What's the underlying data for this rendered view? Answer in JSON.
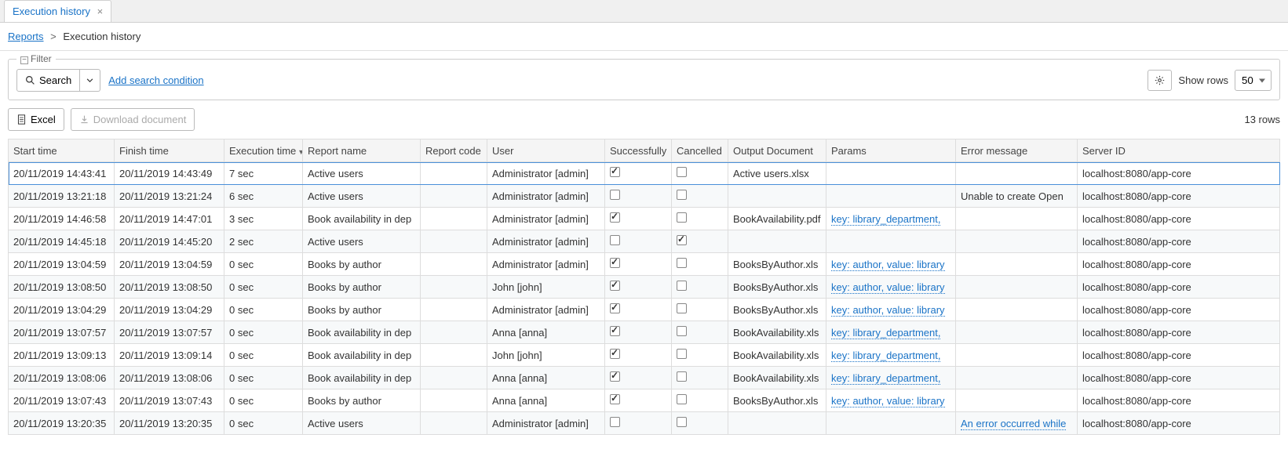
{
  "tab": {
    "label": "Execution history"
  },
  "breadcrumb": {
    "root": "Reports",
    "sep": ">",
    "current": "Execution history"
  },
  "filter": {
    "legend": "Filter",
    "search_label": "Search",
    "add_condition": "Add search condition",
    "show_rows_label": "Show rows",
    "show_rows_value": "50"
  },
  "toolbar": {
    "excel": "Excel",
    "download": "Download document",
    "rows_count": "13 rows"
  },
  "columns": {
    "start": "Start time",
    "finish": "Finish time",
    "exec": "Execution time",
    "name": "Report name",
    "code": "Report code",
    "user": "User",
    "succ": "Successfully",
    "canc": "Cancelled",
    "out": "Output Document",
    "params": "Params",
    "err": "Error message",
    "srv": "Server ID"
  },
  "rows": [
    {
      "start": "20/11/2019 14:43:41",
      "finish": "20/11/2019 14:43:49",
      "exec": "7 sec",
      "name": "Active users",
      "code": "",
      "user": "Administrator [admin]",
      "succ": true,
      "canc": false,
      "out": "Active users.xlsx",
      "params": "",
      "err": "",
      "srv": "localhost:8080/app-core",
      "selected": true
    },
    {
      "start": "20/11/2019 13:21:18",
      "finish": "20/11/2019 13:21:24",
      "exec": "6 sec",
      "name": "Active users",
      "code": "",
      "user": "Administrator [admin]",
      "succ": false,
      "canc": false,
      "out": "",
      "params": "",
      "err": "Unable to create Open ",
      "srv": "localhost:8080/app-core"
    },
    {
      "start": "20/11/2019 14:46:58",
      "finish": "20/11/2019 14:47:01",
      "exec": "3 sec",
      "name": "Book availability in dep",
      "code": "",
      "user": "Administrator [admin]",
      "succ": true,
      "canc": false,
      "out": "BookAvailability.pdf",
      "params": "key: library_department, ",
      "err": "",
      "srv": "localhost:8080/app-core"
    },
    {
      "start": "20/11/2019 14:45:18",
      "finish": "20/11/2019 14:45:20",
      "exec": "2 sec",
      "name": "Active users",
      "code": "",
      "user": "Administrator [admin]",
      "succ": false,
      "canc": true,
      "out": "",
      "params": "",
      "err": "",
      "srv": "localhost:8080/app-core"
    },
    {
      "start": "20/11/2019 13:04:59",
      "finish": "20/11/2019 13:04:59",
      "exec": "0 sec",
      "name": "Books by author",
      "code": "",
      "user": "Administrator [admin]",
      "succ": true,
      "canc": false,
      "out": "BooksByAuthor.xls",
      "params": "key: author, value: library",
      "err": "",
      "srv": "localhost:8080/app-core"
    },
    {
      "start": "20/11/2019 13:08:50",
      "finish": "20/11/2019 13:08:50",
      "exec": "0 sec",
      "name": "Books by author",
      "code": "",
      "user": "John [john]",
      "succ": true,
      "canc": false,
      "out": "BooksByAuthor.xls",
      "params": "key: author, value: library",
      "err": "",
      "srv": "localhost:8080/app-core"
    },
    {
      "start": "20/11/2019 13:04:29",
      "finish": "20/11/2019 13:04:29",
      "exec": "0 sec",
      "name": "Books by author",
      "code": "",
      "user": "Administrator [admin]",
      "succ": true,
      "canc": false,
      "out": "BooksByAuthor.xls",
      "params": "key: author, value: library",
      "err": "",
      "srv": "localhost:8080/app-core"
    },
    {
      "start": "20/11/2019 13:07:57",
      "finish": "20/11/2019 13:07:57",
      "exec": "0 sec",
      "name": "Book availability in dep",
      "code": "",
      "user": "Anna [anna]",
      "succ": true,
      "canc": false,
      "out": "BookAvailability.xls",
      "params": "key: library_department, ",
      "err": "",
      "srv": "localhost:8080/app-core"
    },
    {
      "start": "20/11/2019 13:09:13",
      "finish": "20/11/2019 13:09:14",
      "exec": "0 sec",
      "name": "Book availability in dep",
      "code": "",
      "user": "John [john]",
      "succ": true,
      "canc": false,
      "out": "BookAvailability.xls",
      "params": "key: library_department, ",
      "err": "",
      "srv": "localhost:8080/app-core"
    },
    {
      "start": "20/11/2019 13:08:06",
      "finish": "20/11/2019 13:08:06",
      "exec": "0 sec",
      "name": "Book availability in dep",
      "code": "",
      "user": "Anna [anna]",
      "succ": true,
      "canc": false,
      "out": "BookAvailability.xls",
      "params": "key: library_department, ",
      "err": "",
      "srv": "localhost:8080/app-core"
    },
    {
      "start": "20/11/2019 13:07:43",
      "finish": "20/11/2019 13:07:43",
      "exec": "0 sec",
      "name": "Books by author",
      "code": "",
      "user": "Anna [anna]",
      "succ": true,
      "canc": false,
      "out": "BooksByAuthor.xls",
      "params": "key: author, value: library",
      "err": "",
      "srv": "localhost:8080/app-core"
    },
    {
      "start": "20/11/2019 13:20:35",
      "finish": "20/11/2019 13:20:35",
      "exec": "0 sec",
      "name": "Active users",
      "code": "",
      "user": "Administrator [admin]",
      "succ": false,
      "canc": false,
      "out": "",
      "params": "",
      "err": "An error occurred while",
      "err_link": true,
      "srv": "localhost:8080/app-core"
    }
  ]
}
